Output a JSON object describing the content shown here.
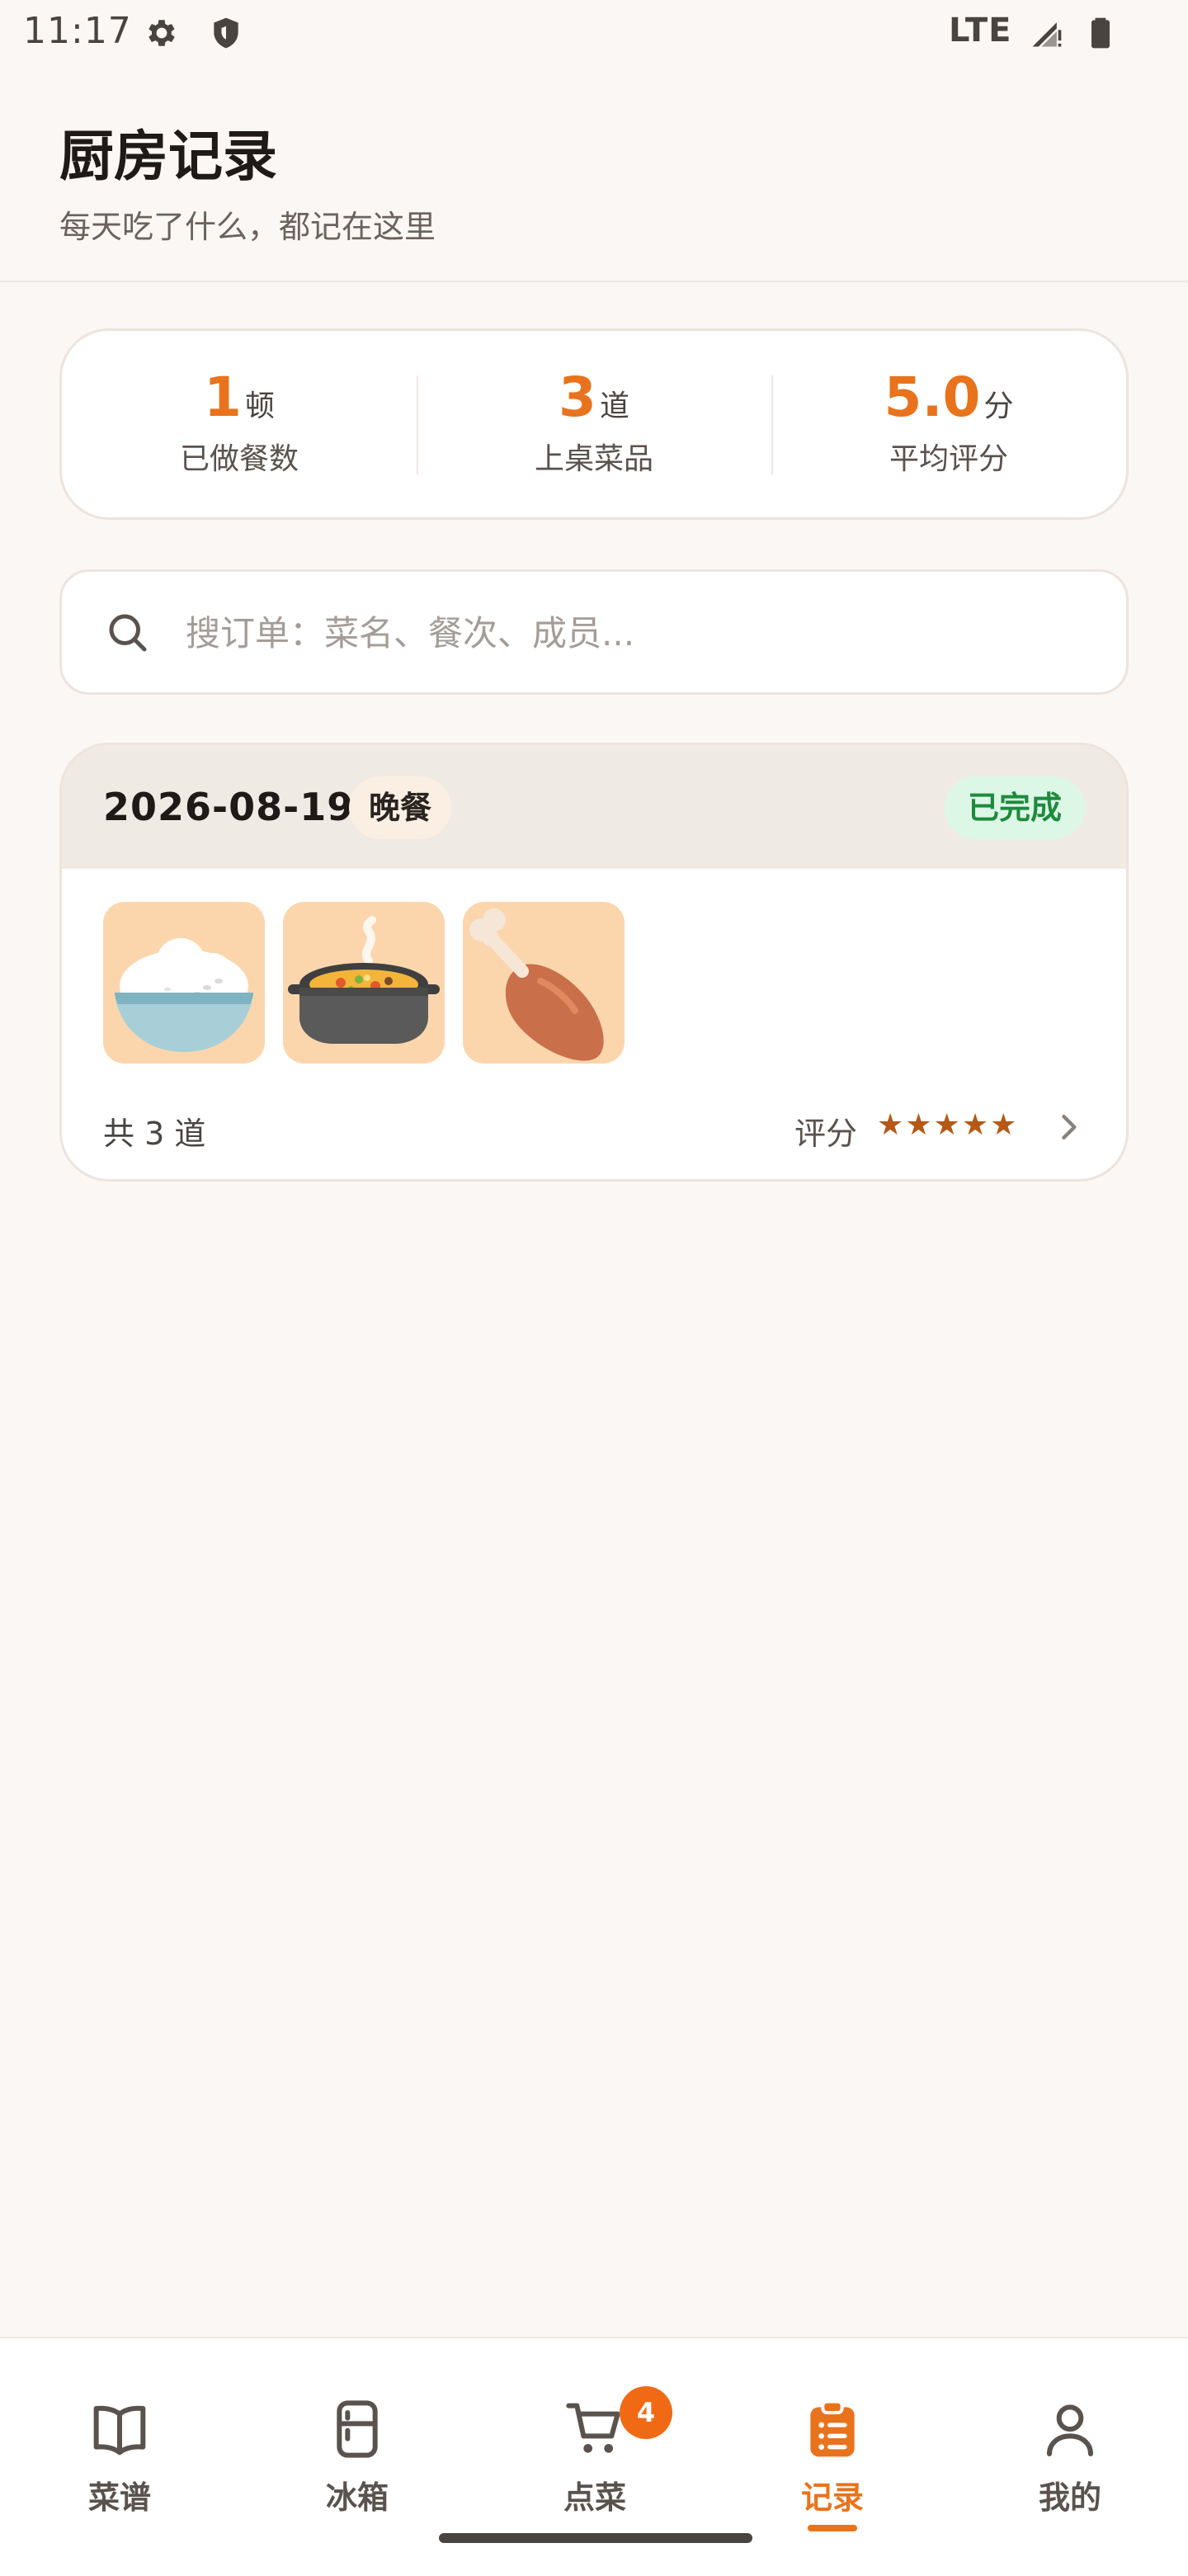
{
  "status_bar": {
    "time": "11:17",
    "network": "LTE",
    "icons": [
      "gear-icon",
      "shield-icon",
      "signal-icon",
      "battery-icon"
    ]
  },
  "header": {
    "title": "厨房记录",
    "subtitle": "每天吃了什么，都记在这里"
  },
  "stats": [
    {
      "value": "1",
      "unit": "顿",
      "label": "已做餐数"
    },
    {
      "value": "3",
      "unit": "道",
      "label": "上桌菜品"
    },
    {
      "value": "5.0",
      "unit": "分",
      "label": "平均评分"
    }
  ],
  "search": {
    "placeholder": "搜订单：菜名、餐次、成员...",
    "value": ""
  },
  "orders": [
    {
      "date": "2026-08-19",
      "meal": "晚餐",
      "status": "已完成",
      "dishes": [
        "rice-bowl-icon",
        "stew-pot-icon",
        "drumstick-icon"
      ],
      "count_text": "共 3 道",
      "rating_label": "评分",
      "rating_stars": "★★★★★",
      "rating_value": 5
    }
  ],
  "nav": {
    "items": [
      {
        "label": "菜谱",
        "icon": "book-icon"
      },
      {
        "label": "冰箱",
        "icon": "fridge-icon"
      },
      {
        "label": "点菜",
        "icon": "cart-icon",
        "badge": "4"
      },
      {
        "label": "记录",
        "icon": "clipboard-icon",
        "active": true
      },
      {
        "label": "我的",
        "icon": "user-icon"
      }
    ]
  },
  "colors": {
    "accent": "#E8731C",
    "background": "#FBF7F4",
    "status_done_bg": "#DDF7E6",
    "status_done_text": "#1E8A3D"
  }
}
